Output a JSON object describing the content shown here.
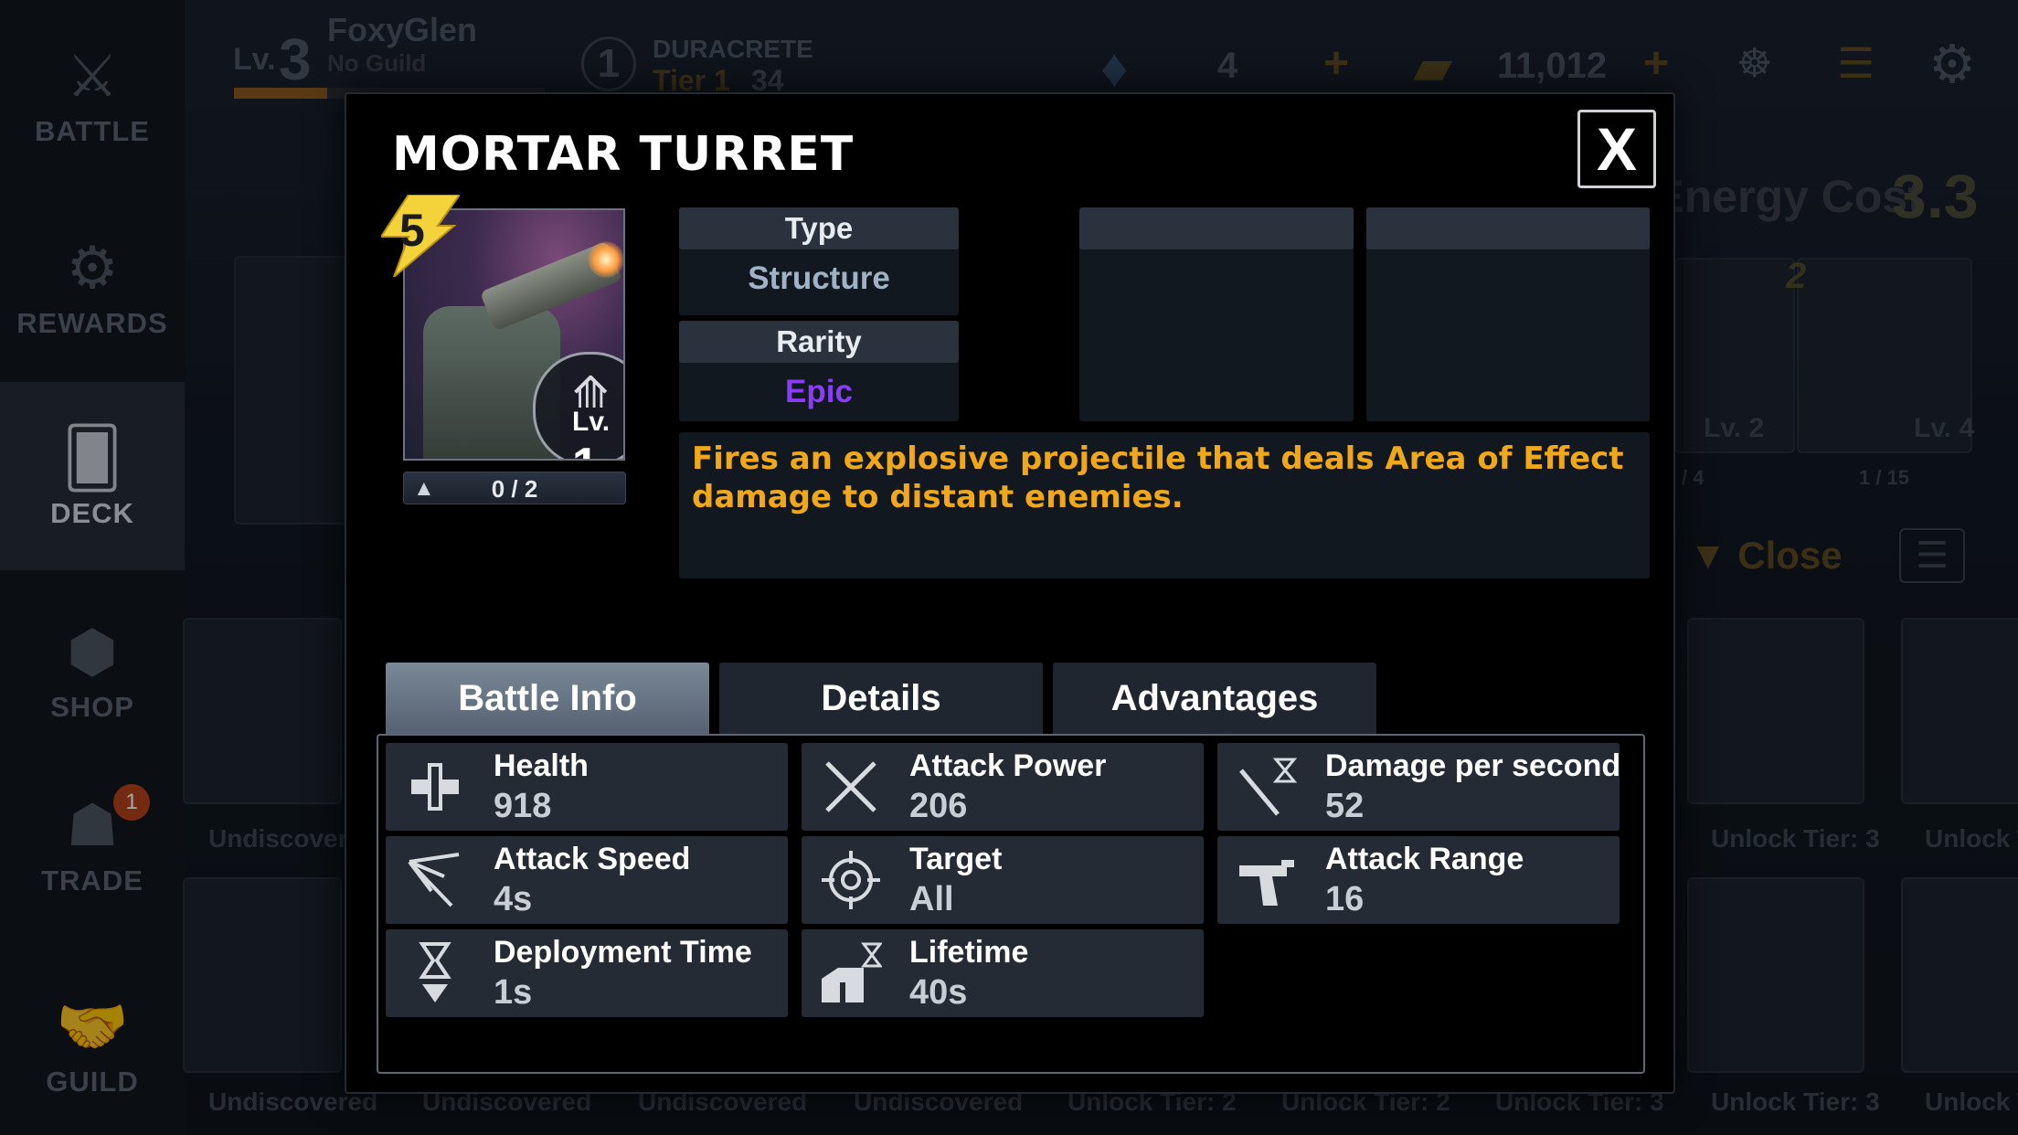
{
  "background": {
    "player": {
      "level_prefix": "Lv.",
      "level": "3",
      "name": "FoxyGlen",
      "guild": "No Guild"
    },
    "resource": {
      "name": "DURACRETE",
      "tier": "Tier 1",
      "amount": "34"
    },
    "crystals": "4",
    "credits": "11,012",
    "average_energy_label": "Average Energy Cost",
    "average_energy_value": "3.3",
    "sidebar": [
      {
        "label": "BATTLE",
        "icon": "crossed-blasters-icon"
      },
      {
        "label": "REWARDS",
        "icon": "rewards-icon"
      },
      {
        "label": "DECK",
        "icon": "cards-icon"
      },
      {
        "label": "SHOP",
        "icon": "shop-icon"
      },
      {
        "label": "TRADE",
        "icon": "trade-icon",
        "badge": "1"
      },
      {
        "label": "GUILD",
        "icon": "handshake-icon"
      }
    ],
    "close_label": "Close",
    "deck_cards": [
      {
        "cost": "2",
        "level": "Lv. 2",
        "progress": "/ 4"
      },
      {
        "cost": "2",
        "level": "Lv. 4",
        "progress": "1 / 15"
      }
    ],
    "collection_labels": [
      "Undiscovered",
      "Undiscovered",
      "Undiscovered",
      "Undiscovered",
      "Undiscovered",
      "Unlock Tier: 2",
      "Unlock Tier: 2",
      "Unlock Tier: 3",
      "Unlock Tier: 3",
      "Unlock Ti",
      "Unlock Tier: 3",
      "Unlock Ti"
    ]
  },
  "modal": {
    "title": "MORTAR TURRET",
    "close_label": "X",
    "card": {
      "cost": "5",
      "level_prefix": "Lv.",
      "level": "1",
      "progress": "0 / 2"
    },
    "type_header": "Type",
    "type_value": "Structure",
    "rarity_header": "Rarity",
    "rarity_value": "Epic",
    "rarity_color": "#8b3df5",
    "description": "Fires an explosive projectile that deals Area of Effect damage to distant enemies.",
    "description_color": "#f0a81a",
    "tabs": [
      {
        "label": "Battle Info",
        "active": true
      },
      {
        "label": "Details",
        "active": false
      },
      {
        "label": "Advantages",
        "active": false
      }
    ],
    "stats": [
      {
        "label": "Health",
        "value": "918",
        "icon": "health-cross-icon"
      },
      {
        "label": "Attack Power",
        "value": "206",
        "icon": "crossed-swords-icon"
      },
      {
        "label": "Damage per second",
        "value": "52",
        "icon": "sword-hourglass-icon"
      },
      {
        "label": "Attack Speed",
        "value": "4s",
        "icon": "speed-claw-icon"
      },
      {
        "label": "Target",
        "value": "All",
        "icon": "crosshair-icon"
      },
      {
        "label": "Attack Range",
        "value": "16",
        "icon": "blaster-icon"
      },
      {
        "label": "Deployment Time",
        "value": "1s",
        "icon": "hourglass-down-icon"
      },
      {
        "label": "Lifetime",
        "value": "40s",
        "icon": "lifetime-structure-icon"
      }
    ]
  }
}
